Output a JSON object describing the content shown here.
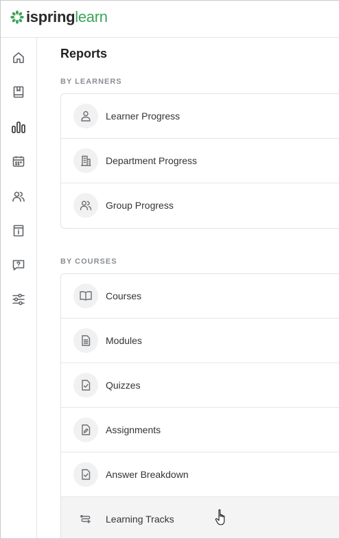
{
  "app": {
    "logo_part1": "ispring",
    "logo_part2": "learn",
    "brand_color": "#3aa35a"
  },
  "sidebar": {
    "items": [
      {
        "icon": "home-icon"
      },
      {
        "icon": "book-icon"
      },
      {
        "icon": "reports-bar-chart-icon",
        "active": true
      },
      {
        "icon": "calendar-icon"
      },
      {
        "icon": "users-icon"
      },
      {
        "icon": "info-board-icon"
      },
      {
        "icon": "question-chat-icon"
      },
      {
        "icon": "settings-sliders-icon"
      }
    ]
  },
  "page": {
    "title": "Reports"
  },
  "sections": {
    "learners": {
      "label": "BY LEARNERS",
      "items": [
        {
          "label": "Learner Progress",
          "icon": "person-icon"
        },
        {
          "label": "Department Progress",
          "icon": "building-icon"
        },
        {
          "label": "Group Progress",
          "icon": "group-icon"
        }
      ]
    },
    "courses": {
      "label": "BY COURSES",
      "items": [
        {
          "label": "Courses",
          "icon": "open-book-icon"
        },
        {
          "label": "Modules",
          "icon": "document-icon"
        },
        {
          "label": "Quizzes",
          "icon": "quiz-check-icon"
        },
        {
          "label": "Assignments",
          "icon": "assignment-pen-icon"
        },
        {
          "label": "Answer Breakdown",
          "icon": "answer-check-icon"
        },
        {
          "label": "Learning Tracks",
          "icon": "track-route-icon"
        }
      ]
    }
  }
}
